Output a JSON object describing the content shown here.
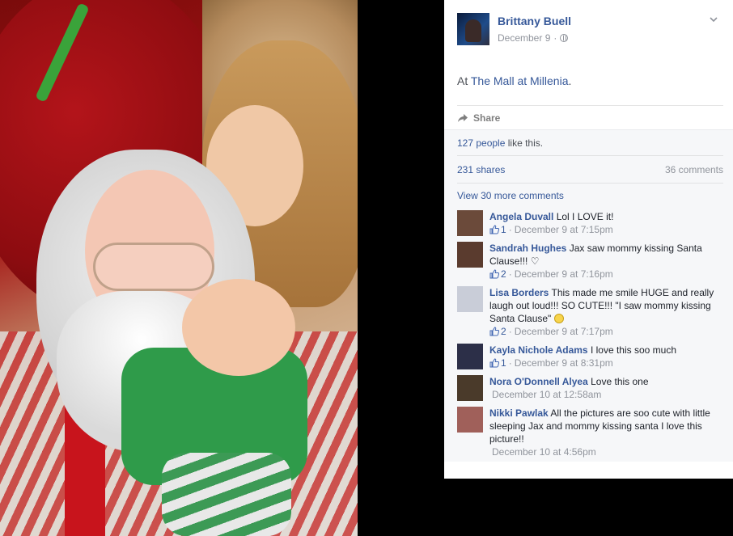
{
  "post": {
    "author": "Brittany Buell",
    "date": "December 9",
    "date_sep": "·",
    "location_prefix": "At",
    "location": "The Mall at Millenia",
    "location_suffix": ".",
    "share_label": "Share",
    "likes_link": "127 people",
    "likes_text": " like this.",
    "shares": "231 shares",
    "comments_count": "36 comments",
    "view_more": "View 30 more comments"
  },
  "comments": [
    {
      "author": "Angela Duvall",
      "text": "Lol I LOVE it!",
      "likes": "1",
      "sep": "·",
      "time": "December 9 at 7:15pm",
      "avatar_color": "#6b4a3a"
    },
    {
      "author": "Sandrah Hughes",
      "text": "Jax saw mommy kissing Santa Clause!!! ♡",
      "likes": "2",
      "sep": "·",
      "time": "December 9 at 7:16pm",
      "avatar_color": "#5a3b2e"
    },
    {
      "author": "Lisa Borders",
      "text": "This made me smile HUGE and really laugh out loud!!! SO CUTE!!! \"I saw mommy kissing Santa Clause\"",
      "likes": "2",
      "sep": "·",
      "time": "December 9 at 7:17pm",
      "avatar_color": "#c9cdd8"
    },
    {
      "author": "Kayla Nichole Adams",
      "text": "I love this soo much",
      "likes": "1",
      "sep": "·",
      "time": "December 9 at 8:31pm",
      "avatar_color": "#2c2f48"
    },
    {
      "author": "Nora O'Donnell Alyea",
      "text": "Love this one",
      "likes": "",
      "sep": "",
      "time": "December 10 at 12:58am",
      "avatar_color": "#4a3a2a"
    },
    {
      "author": "Nikki Pawlak",
      "text": "All the pictures are soo cute with little sleeping Jax and mommy kissing santa I love this picture!!",
      "likes": "",
      "sep": "",
      "time": "December 10 at 4:56pm",
      "avatar_color": "#a0605a"
    }
  ],
  "colors": {
    "link": "#365899",
    "meta": "#90949c",
    "panel_bg": "#ffffff",
    "feedback_bg": "#f6f7f9"
  },
  "icons": {
    "chevron": "chevron-down-icon",
    "globe": "globe-icon",
    "share": "share-arrow-icon",
    "thumb": "thumbs-up-icon"
  }
}
